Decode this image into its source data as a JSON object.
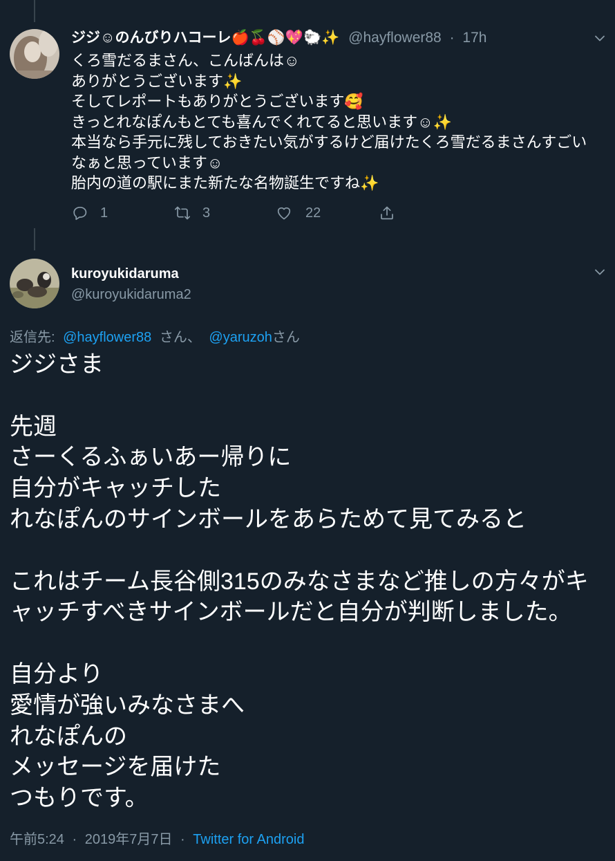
{
  "theme": {
    "background": "#15202B",
    "text": "#FFFFFF",
    "secondary_text": "#8899A6",
    "link": "#1DA1F2",
    "thread_line": "#38444D"
  },
  "parent_tweet": {
    "avatar_icon": "user-avatar",
    "display_name": "ジジ☺のんびりハコーレ🍎🍒⚾💖🐑✨",
    "handle": "@hayflower88",
    "separator": "·",
    "time": "17h",
    "menu_icon": "chevron-down-icon",
    "body_lines": [
      "くろ雪だるまさん、こんばんは☺",
      "ありがとうございます✨",
      "そしてレポートもありがとうございます🥰",
      "きっとれなぽんもとても喜んでくれてると思います☺✨",
      "本当なら手元に残しておきたい気がするけど届けたくろ雪だるまさんすごい",
      "なぁと思っています☺",
      "胎内の道の駅にまた新たな名物誕生ですね✨"
    ],
    "actions": {
      "reply": {
        "icon": "reply-icon",
        "count": "1"
      },
      "retweet": {
        "icon": "retweet-icon",
        "count": "3"
      },
      "like": {
        "icon": "heart-icon",
        "count": "22"
      },
      "share": {
        "icon": "share-icon"
      }
    }
  },
  "main_tweet": {
    "avatar_icon": "user-avatar",
    "display_name": "kuroyukidaruma",
    "handle": "@kuroyukidaruma2",
    "menu_icon": "chevron-down-icon",
    "reply_to": {
      "prefix": "返信先:",
      "mentions": [
        {
          "handle": "@hayflower88",
          "suffix": "さん、"
        },
        {
          "handle": "@yaruzoh",
          "suffix": "さん"
        }
      ]
    },
    "paragraphs": [
      [
        "ジジさま"
      ],
      [
        "先週",
        "さーくるふぁいあー帰りに",
        "自分がキャッチした",
        "れなぽんのサインボールをあらためて見てみると"
      ],
      [
        "これはチーム長谷側315のみなさまなど推しの方々がキ",
        "ャッチすべきサインボールだと自分が判断しました。"
      ],
      [
        "自分より",
        "愛情が強いみなさまへ",
        "れなぽんの",
        "メッセージを届けた",
        "つもりです。"
      ]
    ],
    "footer": {
      "time": "午前5:24",
      "separator": "·",
      "date": "2019年7月7日",
      "source": "Twitter for Android"
    }
  }
}
